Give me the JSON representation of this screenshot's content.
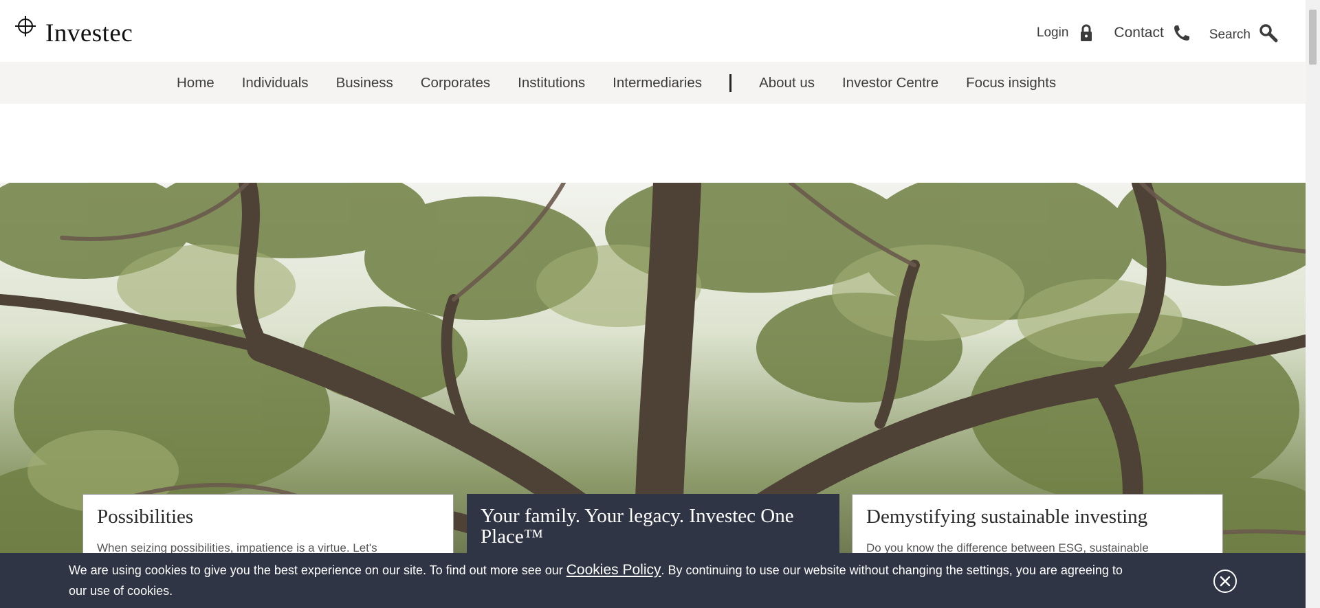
{
  "brand": {
    "name": "Investec",
    "logo_icon": "crosshair-logo-icon"
  },
  "utilities": {
    "login": {
      "label": "Login",
      "icon": "lock-icon"
    },
    "contact": {
      "label": "Contact",
      "icon": "phone-icon"
    },
    "search": {
      "label": "Search",
      "icon": "search-icon"
    }
  },
  "nav": {
    "primary": [
      "Home",
      "Individuals",
      "Business",
      "Corporates",
      "Institutions",
      "Intermediaries"
    ],
    "secondary": [
      "About us",
      "Investor Centre",
      "Focus insights"
    ]
  },
  "cards": [
    {
      "title": "Possibilities",
      "text": "When seizing possibilities, impatience is a virtue. Let's"
    },
    {
      "title": "Your family. Your legacy. Investec One Place™",
      "text": ""
    },
    {
      "title": "Demystifying sustainable investing",
      "text": "Do you know the difference between ESG, sustainable"
    }
  ],
  "cookie_banner": {
    "text_before": "We are using cookies to give you the best experience on our site. To find out more see our ",
    "link": "Cookies Policy",
    "text_after": ". By continuing to use our website without changing the settings, you are agreeing to our use of cookies.",
    "close_icon": "close-circle-icon"
  },
  "colors": {
    "navbar_bg": "#f5f4f2",
    "dark_panel": "#2f3545",
    "text": "#3c3c3c"
  }
}
